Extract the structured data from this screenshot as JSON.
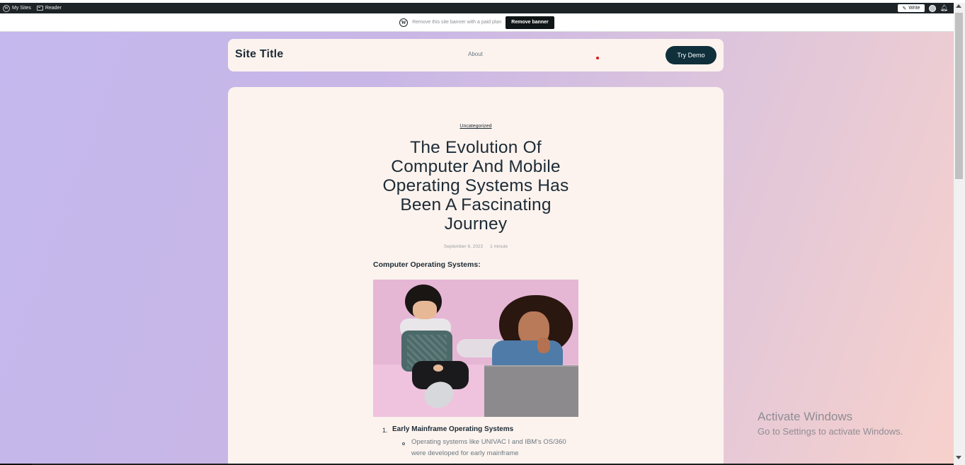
{
  "admin_bar": {
    "my_sites": "My Sites",
    "reader": "Reader",
    "write": "Write"
  },
  "banner": {
    "message": "Remove this site banner with a paid plan",
    "button": "Remove banner"
  },
  "site": {
    "title": "Site Title",
    "nav": [
      "About"
    ],
    "cta": "Try Demo"
  },
  "post": {
    "category": "Uncategorized",
    "title": "The Evolution Of Computer And Mobile Operating Systems Has Been A Fascinating Journey",
    "date": "September 6, 2023",
    "read_time": "1 minute",
    "section_heading": "Computer Operating Systems:",
    "list": [
      {
        "number": "1.",
        "title": "Early Mainframe Operating Systems",
        "bullet_text": "Operating systems like UNIVAC I and IBM's OS/360 were developed for early mainframe"
      }
    ]
  },
  "watermark": {
    "line1": "Activate Windows",
    "line2": "Go to Settings to activate Windows."
  },
  "colors": {
    "admin_bar": "#1d2327",
    "card_bg": "#fcf3ee",
    "accent_button": "#0f2f3b",
    "text_dark": "#1d2b36",
    "notification_dot": "#e0151b"
  }
}
